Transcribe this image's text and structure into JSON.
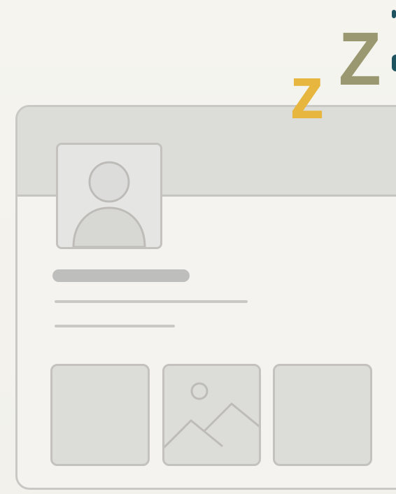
{
  "decor": {
    "sleep_small": "z",
    "sleep_large": "Z",
    "colors": {
      "sleep_small": "#e6b63f",
      "sleep_large": "#9a9870",
      "edge_accent": "#1e5360",
      "card_border": "#c9c8c4",
      "card_header": "#dcdcd9",
      "placeholder_fill": "#e5e5e3",
      "placeholder_stroke": "#c3c2be"
    }
  },
  "profile_card": {
    "avatar_icon": "user-placeholder-icon",
    "name_placeholder": "name-skeleton",
    "text_placeholders": [
      "line-long",
      "line-short"
    ],
    "gallery": [
      {
        "icon": "empty-thumbnail"
      },
      {
        "icon": "image-placeholder-icon"
      },
      {
        "icon": "empty-thumbnail"
      }
    ]
  }
}
